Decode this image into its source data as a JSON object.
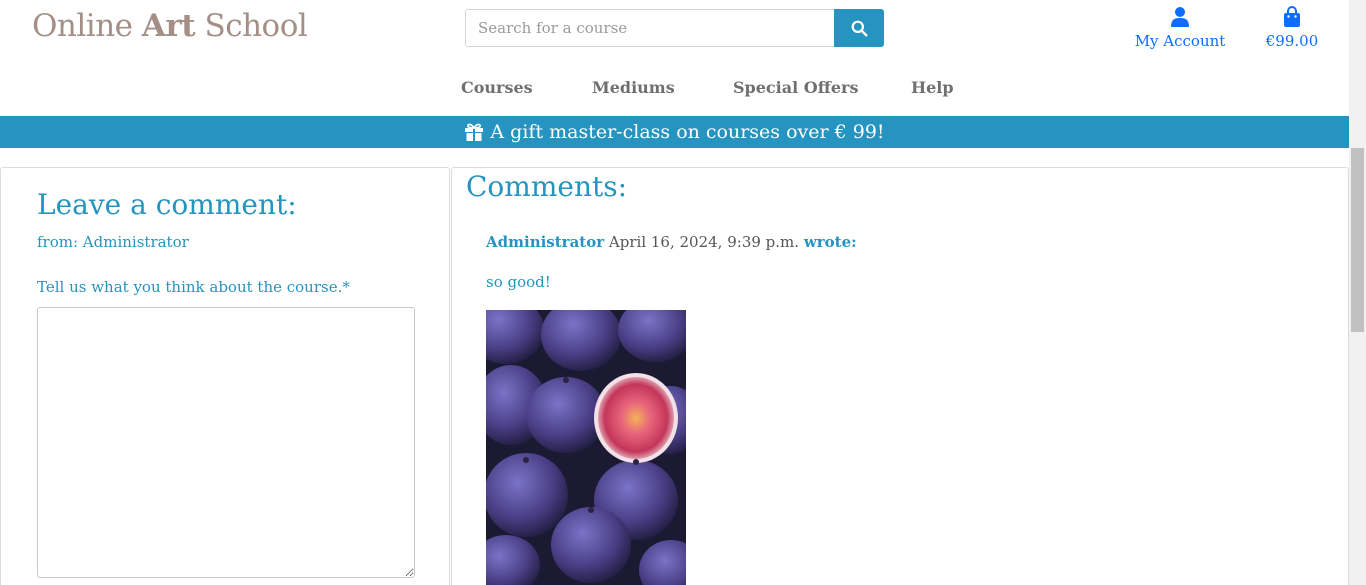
{
  "header": {
    "logo_prefix": "Online",
    "logo_bold": "Art",
    "logo_suffix": "School",
    "search_placeholder": "Search for a course",
    "search_icon": "search-icon",
    "account_label": "My Account",
    "account_icon": "user-icon",
    "cart_total": "€99.00",
    "cart_icon": "shopping-bag-icon"
  },
  "nav": {
    "items": [
      "Courses",
      "Mediums",
      "Special Offers",
      "Help"
    ]
  },
  "banner": {
    "icon": "gift-icon",
    "text": "A gift master-class on courses over € 99!"
  },
  "comment_form": {
    "title": "Leave a comment:",
    "from": "from: Administrator",
    "prompt": "Tell us what you think about the course.*",
    "value": ""
  },
  "comments": {
    "title": "Comments:",
    "items": [
      {
        "author": "Administrator",
        "date": "April 16, 2024, 9:39 p.m.",
        "wrote": "wrote:",
        "text": "so good!",
        "image": "figs-photo"
      }
    ]
  },
  "colors": {
    "accent": "#2594c0",
    "link": "#0d6efd",
    "logo": "#a38f86",
    "nav": "#6f6f6f"
  }
}
